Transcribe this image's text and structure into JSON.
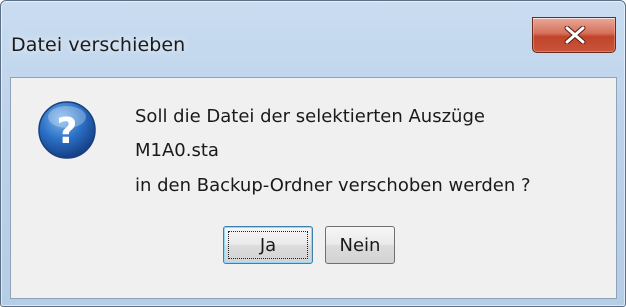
{
  "window": {
    "title": "Datei verschieben",
    "close_icon": "close-icon"
  },
  "dialog": {
    "icon": "question-icon",
    "message_lines": [
      "Soll die Datei der selektierten Auszüge",
      "M1A0.sta",
      "in den Backup-Ordner verschoben werden ?"
    ],
    "buttons": {
      "yes_label": "Ja",
      "no_label": "Nein"
    }
  },
  "colors": {
    "close_button": "#c7462c",
    "icon_blue": "#1f5fb3",
    "focus_border": "#3c7fb1"
  }
}
